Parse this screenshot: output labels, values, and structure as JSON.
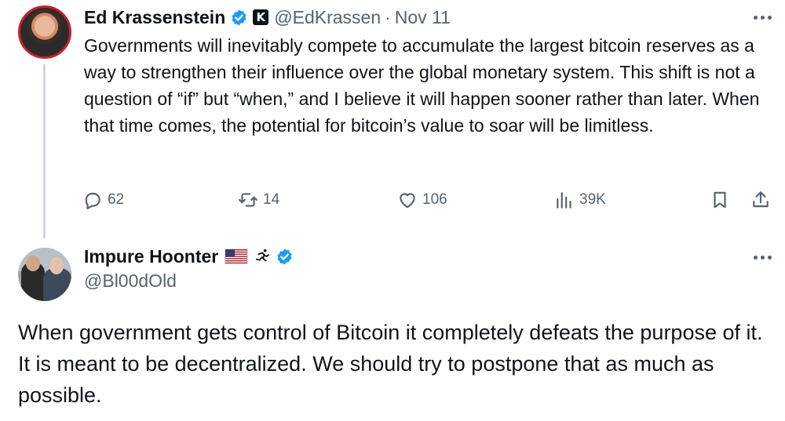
{
  "tweet1": {
    "author_name": "Ed Krassenstein",
    "affiliate_badge": "K",
    "handle": "@EdKrassen",
    "separator": "·",
    "date": "Nov 11",
    "text": "Governments will inevitably compete to accumulate the largest bitcoin reserves as a way to strengthen their influence over the global monetary system. This shift is not a question of “if” but “when,” and I believe it will happen sooner rather than later. When that time comes, the potential for bitcoin’s value to soar will be limitless.",
    "replies": "62",
    "reposts": "14",
    "likes": "106",
    "views": "39K"
  },
  "tweet2": {
    "author_name": "Impure Hoonter",
    "handle": "@Bl00dOld",
    "text": "When government gets control of Bitcoin it completely defeats the purpose of it. It is meant to be decentralized. We should try to postpone that as much as possible."
  },
  "colors": {
    "text": "#0f1419",
    "muted": "#536471",
    "verified": "#1d9bf0",
    "thread_line": "#cfd9de"
  },
  "icons": [
    "verified-icon",
    "affiliate-badge-icon",
    "more-icon",
    "reply-icon",
    "repost-icon",
    "like-icon",
    "views-icon",
    "bookmark-icon",
    "share-icon",
    "us-flag-icon",
    "runner-icon"
  ]
}
